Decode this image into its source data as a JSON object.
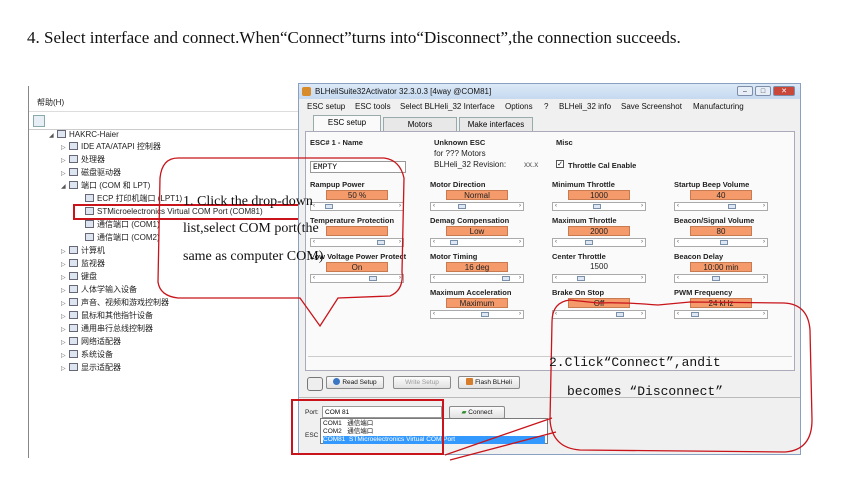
{
  "instruction": "4. Select interface and connect.When“Connect”turns into“Disconnect”,the connection succeeds.",
  "device_manager": {
    "menu": "帮助(H)",
    "tree": [
      {
        "label": "HAKRC-Haier",
        "icon": "computer-icon"
      },
      {
        "label": "IDE ATA/ATAPI 控制器",
        "icon": "ide-controller-icon"
      },
      {
        "label": "处理器",
        "icon": "processor-icon"
      },
      {
        "label": "磁盘驱动器",
        "icon": "disk-icon"
      },
      {
        "label": "端口 (COM 和 LPT)",
        "icon": "port-icon"
      },
      {
        "label": "ECP 打印机端口 (LPT1)",
        "icon": "port-icon"
      },
      {
        "label": "STMicroelectronics Virtual COM Port (COM81)",
        "icon": "port-icon"
      },
      {
        "label": "通信端口 (COM1)",
        "icon": "port-icon"
      },
      {
        "label": "通信端口 (COM2)",
        "icon": "port-icon"
      },
      {
        "label": "计算机",
        "icon": "computer-icon"
      },
      {
        "label": "监视器",
        "icon": "monitor-icon"
      },
      {
        "label": "键盘",
        "icon": "keyboard-icon"
      },
      {
        "label": "人体学输入设备",
        "icon": "hid-icon"
      },
      {
        "label": "声音、视频和游戏控制器",
        "icon": "sound-icon"
      },
      {
        "label": "鼠标和其他指针设备",
        "icon": "mouse-icon"
      },
      {
        "label": "通用串行总线控制器",
        "icon": "usb-icon"
      },
      {
        "label": "网络适配器",
        "icon": "network-icon"
      },
      {
        "label": "系统设备",
        "icon": "system-icon"
      },
      {
        "label": "显示适配器",
        "icon": "display-icon"
      }
    ]
  },
  "blheli": {
    "title": "BLHeliSuite32Activator 32.3.0.3  [4way @COM81]",
    "window_buttons": [
      "–",
      "□",
      "✕"
    ],
    "menu": [
      "ESC setup",
      "ESC tools",
      "Select BLHeli_32 Interface",
      "Options",
      "?",
      "BLHeli_32 info",
      "Save Screenshot",
      "Manufacturing"
    ],
    "tabs": [
      "ESC setup",
      "Motors",
      "Make interfaces"
    ],
    "esc": {
      "name_label": "ESC# 1 - Name",
      "name_value": "EMPTY",
      "unknown_label": "Unknown ESC",
      "unknown_line1": "for ??? Motors",
      "unknown_line2": "BLHeli_32 Revision:",
      "unknown_rev": "xx.x",
      "misc_label": "Misc",
      "throttle_cal": "Throttle Cal Enable"
    },
    "params": [
      {
        "label": "Rampup Power",
        "value": "50 %"
      },
      {
        "label": "Motor Direction",
        "value": "Normal"
      },
      {
        "label": "Minimum Throttle",
        "value": "1000"
      },
      {
        "label": "Startup Beep Volume",
        "value": "40"
      },
      {
        "label": "Temperature Protection",
        "value": ""
      },
      {
        "label": "Demag Compensation",
        "value": "Low"
      },
      {
        "label": "Maximum Throttle",
        "value": "2000"
      },
      {
        "label": "Beacon/Signal Volume",
        "value": "80"
      },
      {
        "label": "Low Voltage Power Protect",
        "value": "On"
      },
      {
        "label": "Motor Timing",
        "value": "16 deg"
      },
      {
        "label": "Center Throttle",
        "value": "1500"
      },
      {
        "label": "Beacon Delay",
        "value": "10:00 min"
      },
      {
        "label": "Maximum Acceleration",
        "value": "Maximum"
      },
      {
        "label": "Brake On Stop",
        "value": "Off"
      },
      {
        "label": "PWM Frequency",
        "value": "24 kHz"
      }
    ],
    "buttons": {
      "read": "Read Setup",
      "write": "Write Setup",
      "flash": "Flash BLHeli",
      "connect": "Connect"
    },
    "port_label": "Port:",
    "port_value": "COM 81",
    "esc_label": "ESC",
    "dropdown": [
      {
        "port": "COM1",
        "desc": "通信端口"
      },
      {
        "port": "COM2",
        "desc": "通信端口"
      },
      {
        "port": "COM81",
        "desc": "STMicroelectronics Virtual COM Port"
      }
    ]
  },
  "callout1": {
    "line1": "1.   Click   the   drop-down",
    "line2": "list,select      COM      port(the",
    "line3": "same as computer COM)"
  },
  "callout2": {
    "line1": "2.Click“Connect”,andit",
    "line2": "becomes “Disconnect”"
  }
}
